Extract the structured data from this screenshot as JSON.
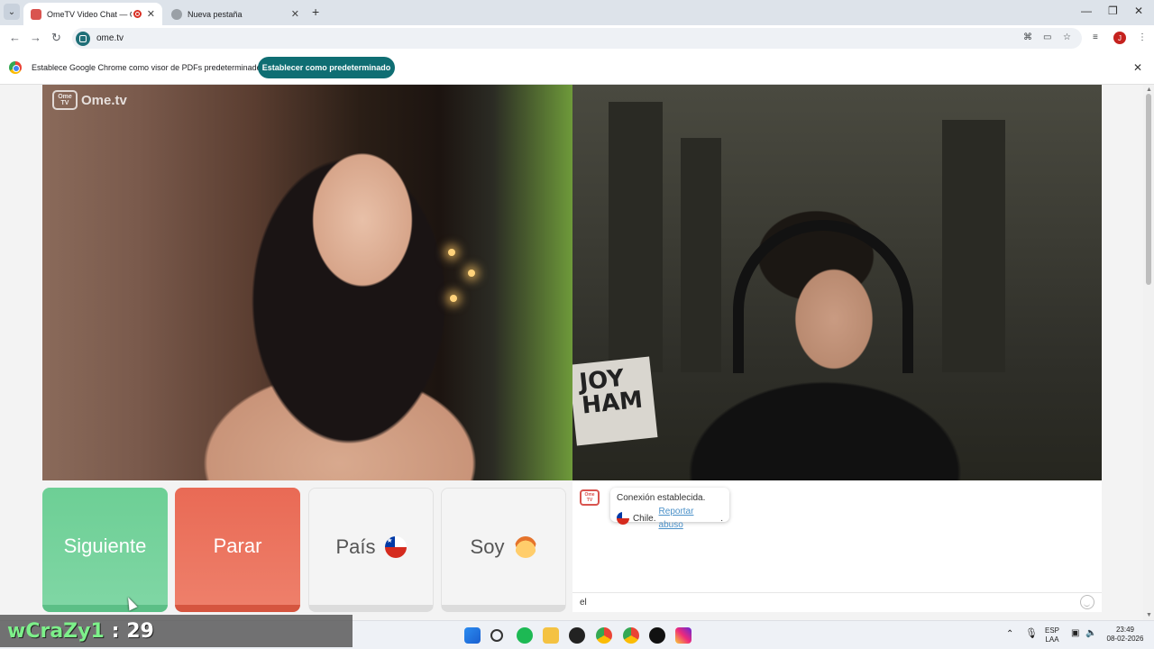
{
  "browser": {
    "tabs": [
      {
        "title": "OmeTV Video Chat — Ome",
        "active": true
      },
      {
        "title": "Nueva pestaña",
        "active": false
      }
    ],
    "url": "ome.tv",
    "profile_initial": "J"
  },
  "infobar": {
    "message": "Establece Google Chrome como visor de PDFs predeterminado",
    "button": "Establecer como predeterminado"
  },
  "video": {
    "logo_small": "Ome TV",
    "logo_text": "Ome.tv",
    "pillow_text": "JOY\nHAM"
  },
  "controls": {
    "next": "Siguiente",
    "stop": "Parar",
    "country": "País",
    "gender": "Soy"
  },
  "chat": {
    "status": "Conexión establecida.",
    "country": "Chile.",
    "report": "Reportar abuso",
    "report_suffix": ".",
    "input_value": "el"
  },
  "overlay": {
    "name": "wCraZy1",
    "score": ": 29"
  },
  "taskbar": {
    "lang_top": "ESP",
    "lang_bottom": "LAA",
    "time": "23:49",
    "date": "08-02-2026"
  },
  "colors": {
    "next": "#6dcf95",
    "stop": "#e96a55",
    "accent": "#0f6e73"
  }
}
